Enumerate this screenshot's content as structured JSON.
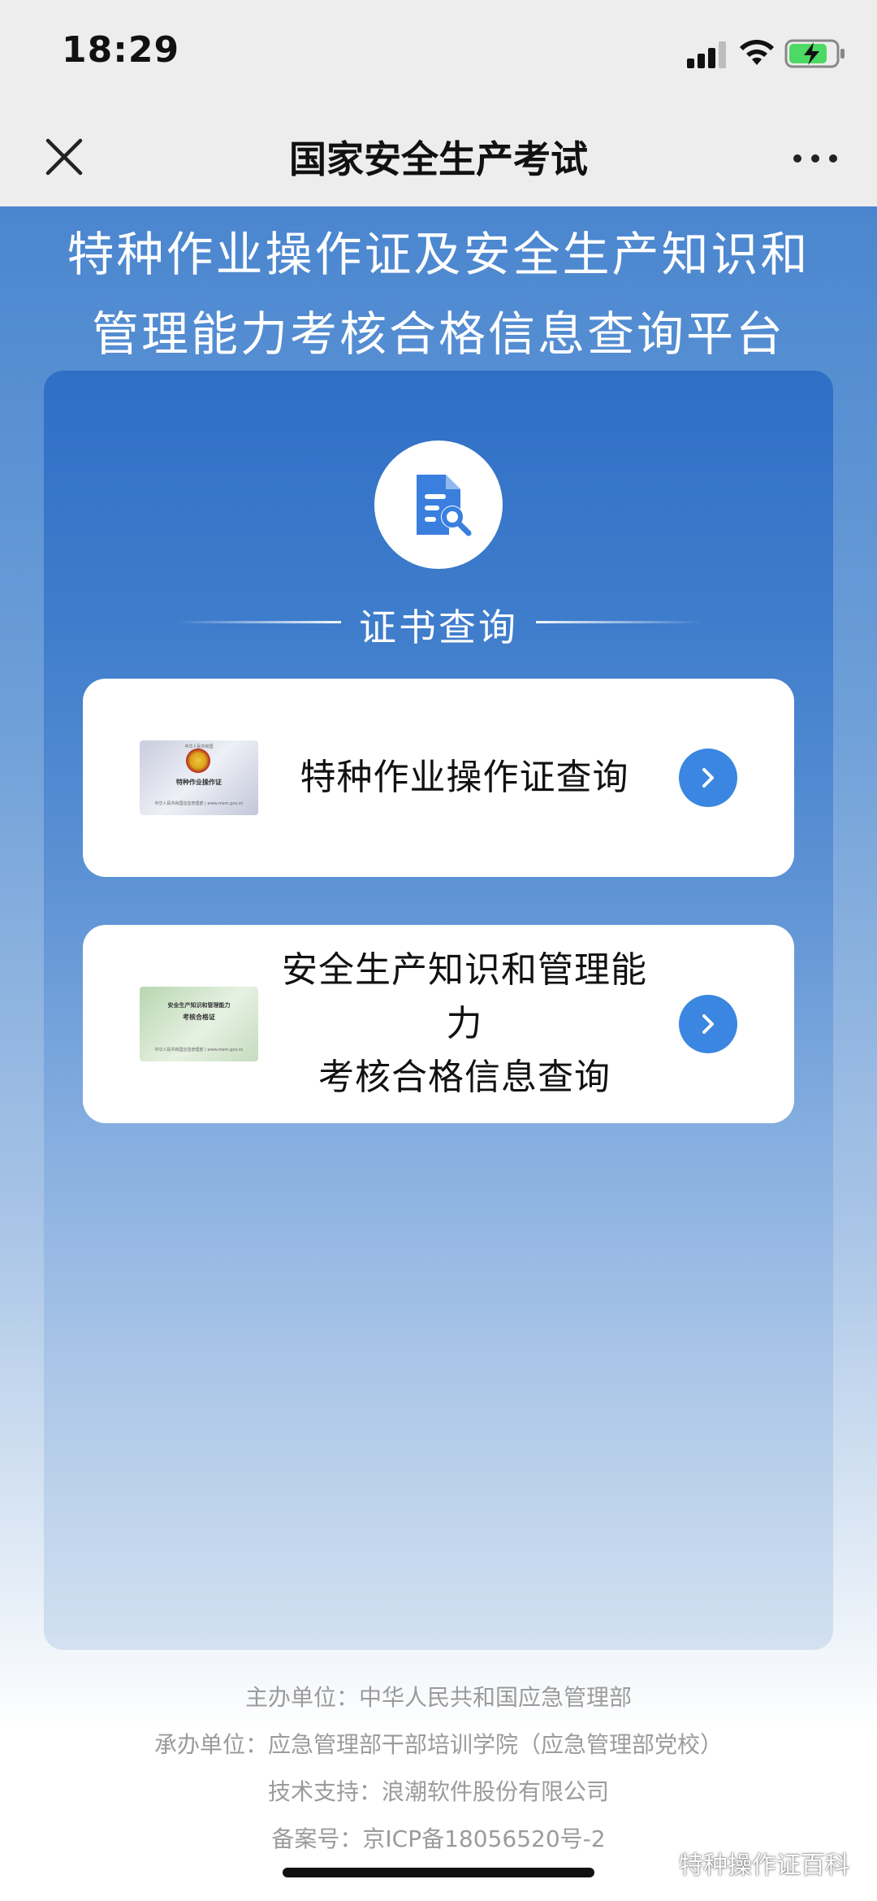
{
  "status_bar": {
    "time": "18:29"
  },
  "nav": {
    "title": "国家安全生产考试",
    "close_icon": "close-icon",
    "more_icon": "more-dots-icon"
  },
  "platform": {
    "title_line1": "特种作业操作证及安全生产知识和",
    "title_line2": "管理能力考核合格信息查询平台"
  },
  "section": {
    "title": "证书查询",
    "icon": "document-search-icon"
  },
  "cards": [
    {
      "label": "特种作业操作证查询",
      "thumb_title": "特种作业操作证",
      "thumb_top": "中华人民共和国",
      "thumb_bottom": "中华人民共和国应急管理部 | www.mem.gov.cn"
    },
    {
      "label_line1": "安全生产知识和管理能",
      "label_line2": "力",
      "label_line3": "考核合格信息查询",
      "thumb_title": "安全生产知识和管理能力",
      "thumb_subtitle": "考核合格证",
      "thumb_bottom": "中华人民共和国应急管理部 | www.mem.gov.cn"
    }
  ],
  "footer": {
    "line1": "主办单位：中华人民共和国应急管理部",
    "line2": "承办单位：应急管理部干部培训学院（应急管理部党校）",
    "line3": "技术支持：浪潮软件股份有限公司",
    "line4": "备案号：京ICP备18056520号-2"
  },
  "watermark": {
    "text": "特种操作证百科"
  },
  "colors": {
    "accent": "#3a86e0",
    "panel_top": "#2f6fc5",
    "nav_bg": "#ededed"
  }
}
